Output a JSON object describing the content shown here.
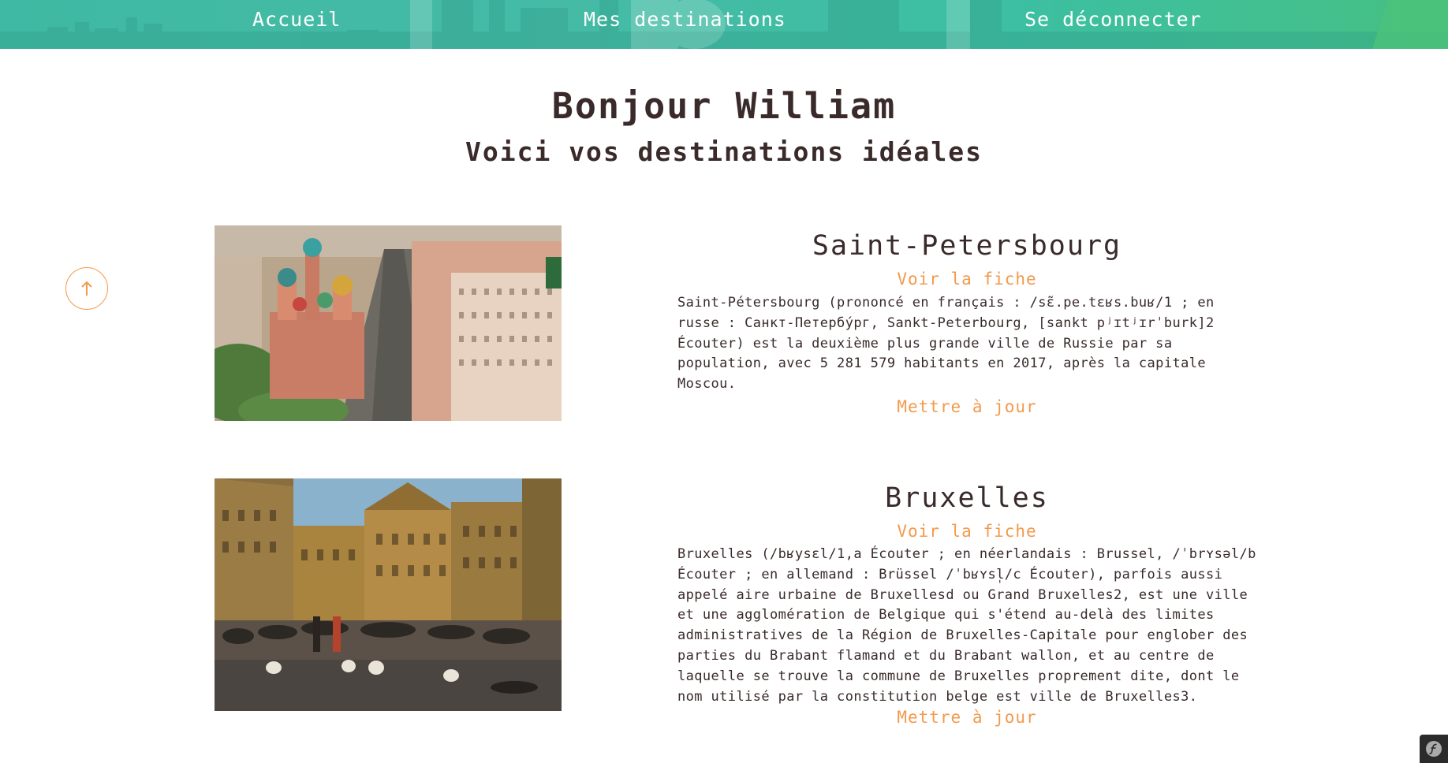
{
  "nav": {
    "home": "Accueil",
    "destinations": "Mes destinations",
    "logout": "Se déconnecter"
  },
  "greeting": "Bonjour William",
  "subtitle": "Voici vos destinations idéales",
  "scroll_top_glyph": "↑",
  "destinations": [
    {
      "name": "Saint-Petersbourg",
      "view_label": "Voir la fiche",
      "description": "Saint-Pétersbourg (prononcé en français : /sɛ̃.pe.tɛʁs.buʁ/1 ; en russe : Санкт-Петербу́рг, Sankt-Peterbourg, [sankt pʲɪtʲɪrˈburk]2 Écouter) est la deuxième plus grande ville de Russie par sa population, avec 5 281 579 habitants en 2017, après la capitale Moscou.",
      "update_label": "Mettre à jour"
    },
    {
      "name": "Bruxelles",
      "view_label": "Voir la fiche",
      "description": "Bruxelles (/bʁysɛl/1,a Écouter ; en néerlandais : Brussel, /ˈbrʏsəl/b Écouter ; en allemand : Brüssel /ˈbʁʏsl̩/c Écouter), parfois aussi appelé aire urbaine de Bruxellesd ou Grand Bruxelles2, est une ville et une agglomération de Belgique qui s'étend au-delà des limites administratives de la Région de Bruxelles-Capitale pour englober des parties du Brabant flamand et du Brabant wallon, et au centre de laquelle se trouve la commune de Bruxelles proprement dite, dont le nom utilisé par la constitution belge est ville de Bruxelles3.",
      "update_label": "Mettre à jour"
    }
  ],
  "colors": {
    "accent": "#f29a4c",
    "text": "#3a2a2a",
    "nav_start": "#3fb9a3",
    "nav_end": "#45c07e"
  }
}
